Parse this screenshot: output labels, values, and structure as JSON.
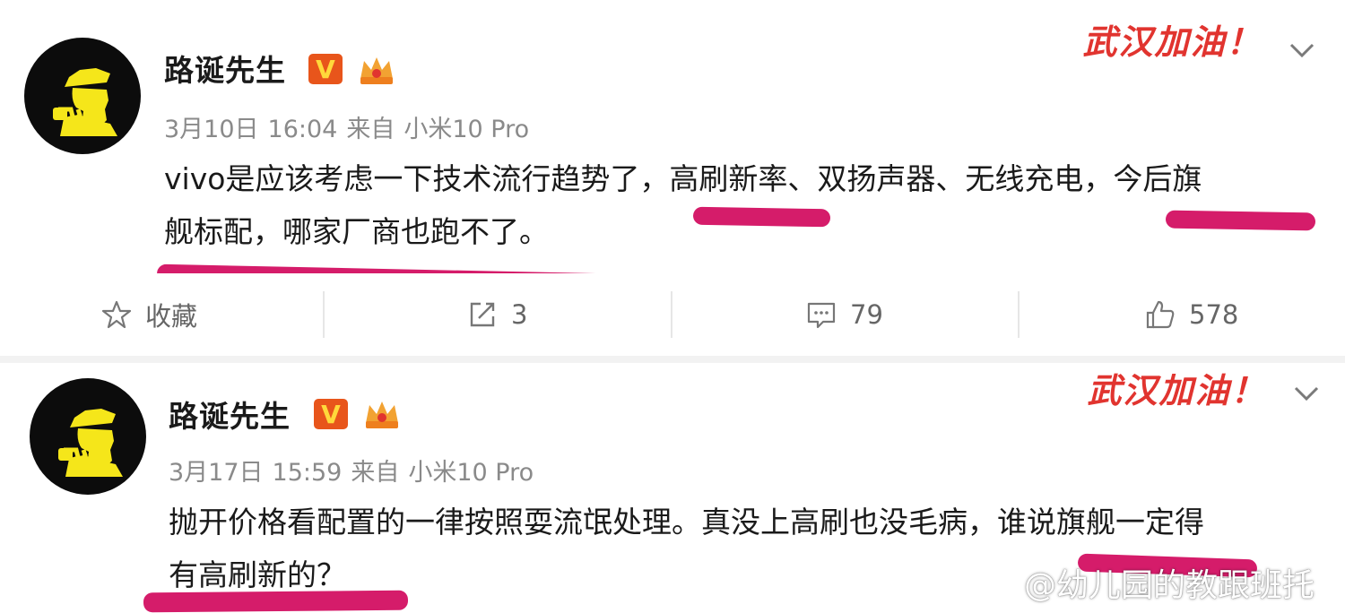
{
  "posts": [
    {
      "username": "路诞先生",
      "verified_badge": "V",
      "date": "3月10日",
      "time": "16:04",
      "source_label": "来自",
      "device": "小米10 Pro",
      "content_line1": "vivo是应该考虑一下技术流行趋势了，高刷新率、双扬声器、无线充电，今后旗",
      "content_line2": "舰标配，哪家厂商也跑不了。",
      "stamp_text": "武汉加油！",
      "actions": {
        "favorite_label": "收藏",
        "repost_count": "3",
        "comment_count": "79",
        "like_count": "578"
      }
    },
    {
      "username": "路诞先生",
      "verified_badge": "V",
      "date": "3月17日",
      "time": "15:59",
      "source_label": "来自",
      "device": "小米10 Pro",
      "content_line1": "抛开价格看配置的一律按照耍流氓处理。真没上高刷也没毛病，谁说旗舰一定得",
      "content_line2": "有高刷新的？",
      "stamp_text": "武汉加油！"
    }
  ],
  "watermark": "@幼儿园的教跟班托",
  "colors": {
    "highlight_mark": "#d51c6a",
    "verified_badge": "#e8551b",
    "stamp_red": "#e1342f",
    "meta_gray": "#8a8a8a",
    "avatar_bg": "#0c0c0c",
    "avatar_figure": "#f5e61a"
  },
  "icons": [
    "detective-avatar-icon",
    "verified-v-icon",
    "crown-badge-icon",
    "chevron-down-icon",
    "star-icon",
    "repost-icon",
    "comment-icon",
    "like-icon",
    "weibo-logo-icon"
  ]
}
